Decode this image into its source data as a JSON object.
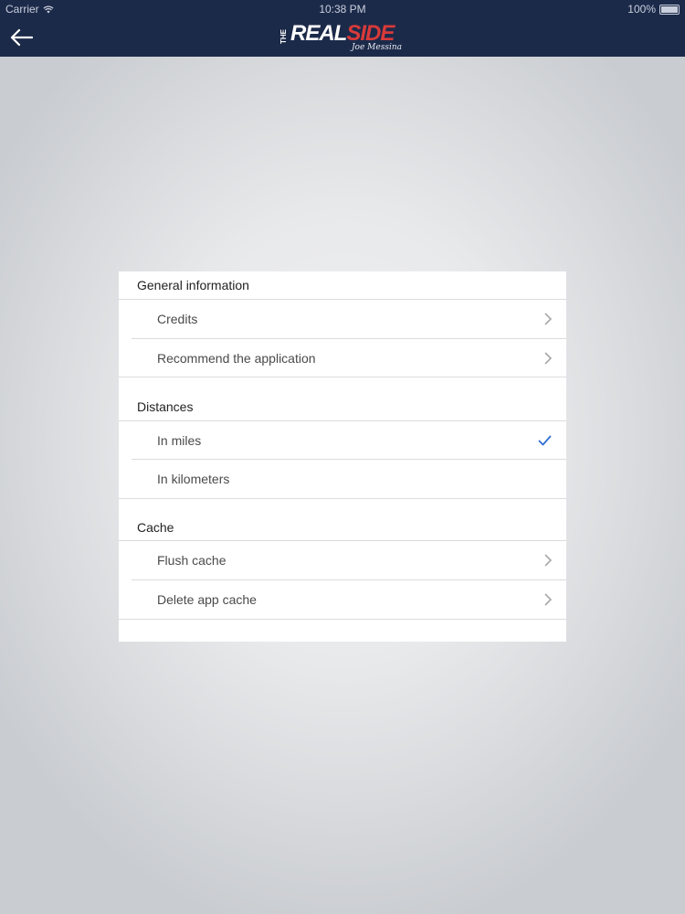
{
  "status_bar": {
    "carrier": "Carrier",
    "time": "10:38 PM",
    "battery": "100%"
  },
  "header": {
    "logo": {
      "the": "THE",
      "real": "REAL",
      "side": "SIDE",
      "byline": "Joe Messina"
    },
    "colors": {
      "background": "#1c2a4a",
      "logo_red": "#d83a3a"
    }
  },
  "settings": {
    "sections": [
      {
        "title": "General information",
        "items": [
          {
            "label": "Credits",
            "accessory": "chevron-right-icon"
          },
          {
            "label": "Recommend the application",
            "accessory": "chevron-right-icon"
          }
        ]
      },
      {
        "title": "Distances",
        "items": [
          {
            "label": "In miles",
            "accessory": "checkmark-icon",
            "selected": true
          },
          {
            "label": "In kilometers",
            "accessory": "none",
            "selected": false
          }
        ]
      },
      {
        "title": "Cache",
        "items": [
          {
            "label": "Flush cache",
            "accessory": "chevron-right-icon"
          },
          {
            "label": "Delete app cache",
            "accessory": "chevron-right-icon"
          }
        ]
      }
    ],
    "colors": {
      "check": "#2f6fd1",
      "chevron": "#a8a8a8"
    }
  }
}
